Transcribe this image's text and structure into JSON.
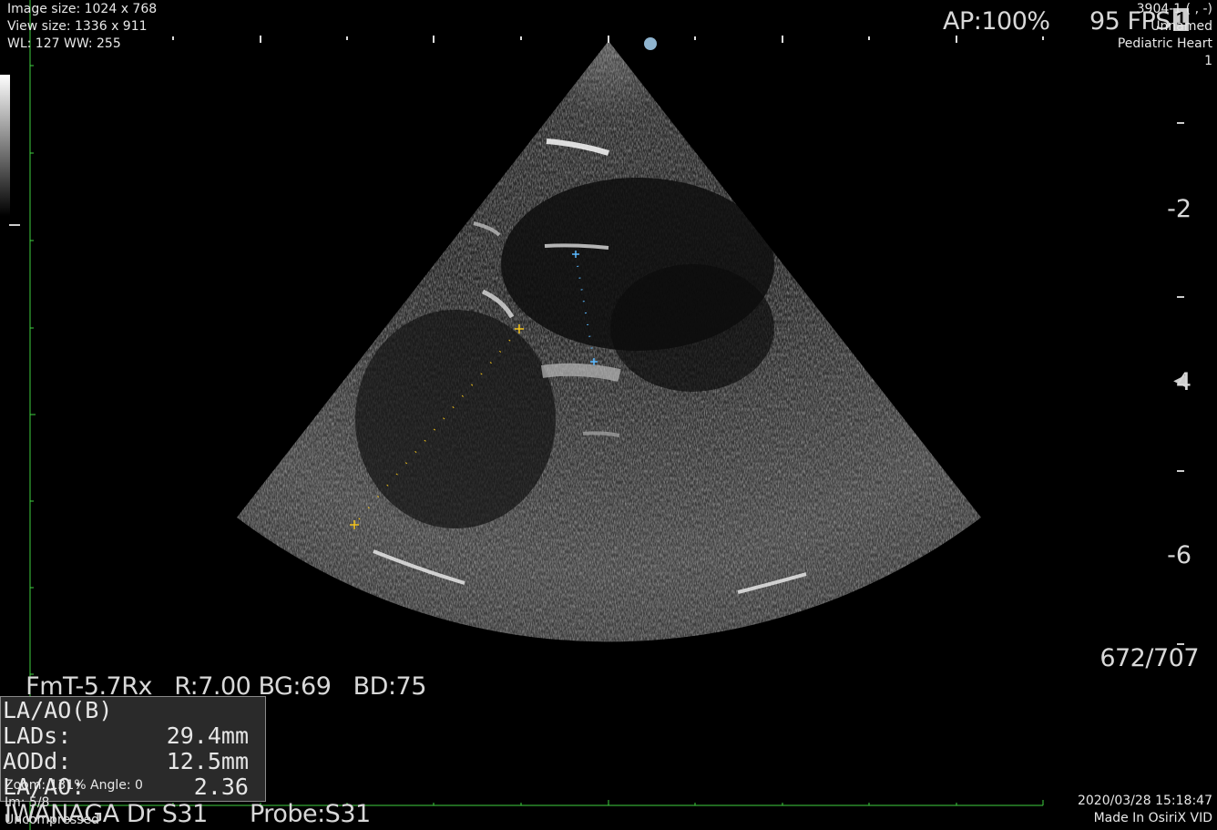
{
  "overlay_top_left": {
    "image_size": "Image size: 1024 x 768",
    "view_size": "View size: 1336 x 911",
    "wl_ww": "WL: 127 WW: 255"
  },
  "overlay_top_right": {
    "ap": "AP:100%",
    "fps": "95 FPS",
    "fps_badge": "1",
    "series_id": "3904-1 (  ,  -)",
    "patient": "Unnamed",
    "study": "Pediatric Heart",
    "index": "1"
  },
  "depth_scale": {
    "labels": [
      "-2",
      "4",
      "-6"
    ],
    "focus_marker": "◀"
  },
  "acquisition": {
    "params": "FmT-5.7Rx",
    "r": "R:7.00",
    "bg": "BG:69",
    "bd": "BD:75",
    "frame": "672/707"
  },
  "measurement": {
    "title": "LA/AO(B)",
    "rows": [
      {
        "label": "LADs:",
        "value": "29.4mm"
      },
      {
        "label": "AODd:",
        "value": "12.5mm"
      },
      {
        "label": "LA/AO:",
        "value": "2.36"
      }
    ]
  },
  "overlay_bottom_left": {
    "zoom": "Zoom: 131%  Angle: 0",
    "image_index": "Im: 5/8",
    "compression": "Uncompressed",
    "operator": "IWANAGA Dr S31",
    "probe": "Probe:S31"
  },
  "overlay_bottom_right": {
    "datetime": "2020/03/28 15:18:47",
    "made_in": "Made In OsiriX VID"
  },
  "colors": {
    "ruler": "#3fd13f",
    "caliper_yellow": "#f2c21a",
    "caliper_blue": "#5ab8ff"
  },
  "icons": [
    "orientation-dot-icon",
    "focus-marker-icon",
    "caliper-cross-icon"
  ]
}
